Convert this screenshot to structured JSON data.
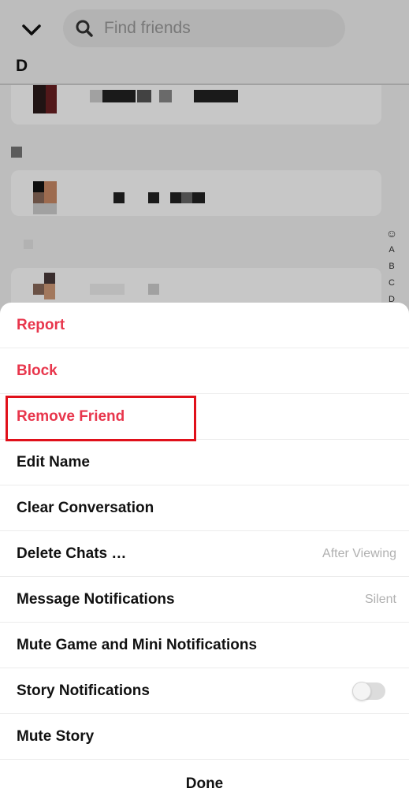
{
  "search": {
    "placeholder": "Find friends"
  },
  "friends_list": {
    "section_letter": "D",
    "az_index": [
      "☺",
      "A",
      "B",
      "C",
      "D"
    ]
  },
  "action_sheet": {
    "items": [
      {
        "label": "Report",
        "style": "danger",
        "value": ""
      },
      {
        "label": "Block",
        "style": "danger",
        "value": ""
      },
      {
        "label": "Remove Friend",
        "style": "danger",
        "value": ""
      },
      {
        "label": "Edit Name",
        "style": "normal",
        "value": ""
      },
      {
        "label": "Clear Conversation",
        "style": "normal",
        "value": ""
      },
      {
        "label": "Delete Chats …",
        "style": "normal",
        "value": "After Viewing"
      },
      {
        "label": "Message Notifications",
        "style": "normal",
        "value": "Silent"
      },
      {
        "label": "Mute Game and Mini Notifications",
        "style": "normal",
        "value": ""
      },
      {
        "label": "Story Notifications",
        "style": "normal",
        "value": "",
        "toggle_on": false
      },
      {
        "label": "Mute Story",
        "style": "normal",
        "value": ""
      }
    ],
    "done_label": "Done"
  },
  "colors": {
    "danger": "#e8364c",
    "highlight": "#e0101a"
  }
}
